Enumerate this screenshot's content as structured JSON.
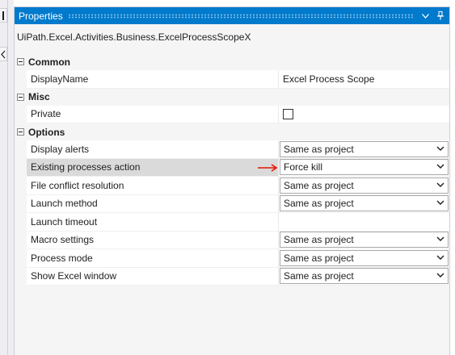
{
  "panel": {
    "title": "Properties",
    "type_name": "UiPath.Excel.Activities.Business.ExcelProcessScopeX"
  },
  "left_strip": {
    "tab1_glyph": "l",
    "tab2_glyph": "<"
  },
  "categories": [
    {
      "name": "Common",
      "properties": [
        {
          "name": "DisplayName",
          "kind": "text",
          "value": "Excel Process Scope"
        }
      ]
    },
    {
      "name": "Misc",
      "properties": [
        {
          "name": "Private",
          "kind": "checkbox",
          "checked": false
        }
      ]
    },
    {
      "name": "Options",
      "properties": [
        {
          "name": "Display alerts",
          "kind": "dropdown",
          "value": "Same as project"
        },
        {
          "name": "Existing processes action",
          "kind": "dropdown",
          "value": "Force kill",
          "selected": true,
          "annotation": "red-arrow"
        },
        {
          "name": "File conflict resolution",
          "kind": "dropdown",
          "value": "Same as project"
        },
        {
          "name": "Launch method",
          "kind": "dropdown",
          "value": "Same as project"
        },
        {
          "name": "Launch timeout",
          "kind": "text",
          "value": ""
        },
        {
          "name": "Macro settings",
          "kind": "dropdown",
          "value": "Same as project"
        },
        {
          "name": "Process mode",
          "kind": "dropdown",
          "value": "Same as project"
        },
        {
          "name": "Show Excel window",
          "kind": "dropdown",
          "value": "Same as project"
        }
      ]
    }
  ],
  "colors": {
    "titlebar": "#007acc",
    "selected_row": "#dadada",
    "annotation_arrow": "#e51400"
  },
  "icons": {
    "collapse": "minus-box-icon",
    "dropdown": "chevron-down-icon",
    "panel_menu": "triangle-down-icon",
    "pin": "pin-icon"
  }
}
